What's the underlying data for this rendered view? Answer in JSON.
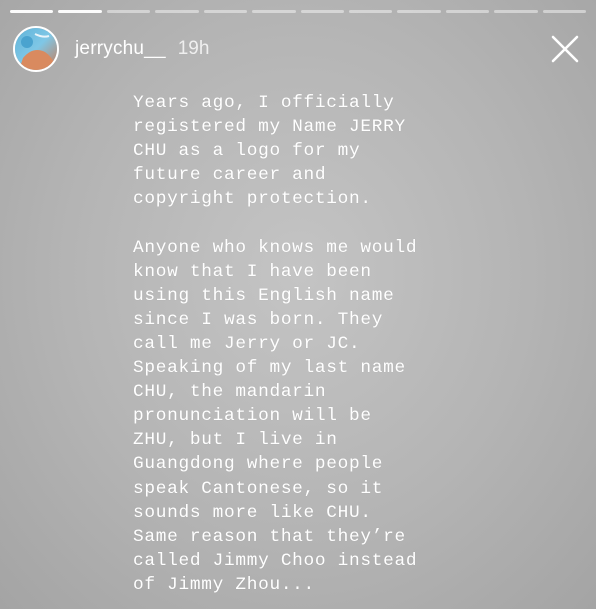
{
  "story": {
    "progress": {
      "segment_count": 12,
      "completed_segments": 2
    },
    "header": {
      "username": "jerrychu__",
      "time_ago": "19h",
      "avatar_icon": "profile-avatar",
      "close_icon": "close-x-icon"
    },
    "text": "Years ago, I officially\nregistered my Name JERRY\nCHU as a logo for my\nfuture career and\ncopyright protection.\n\nAnyone who knows me would\nknow that I have been\nusing this English name\nsince I was born. They\ncall me Jerry or JC.\nSpeaking of my last name\nCHU, the mandarin\npronunciation will be\nZHU, but I live in\nGuangdong where people\nspeak Cantonese, so it\nsounds more like CHU.\nSame reason that they’re\ncalled Jimmy Choo instead\nof Jimmy Zhou...",
    "colors": {
      "background": "#b8b8b8",
      "text": "#ffffff"
    }
  }
}
